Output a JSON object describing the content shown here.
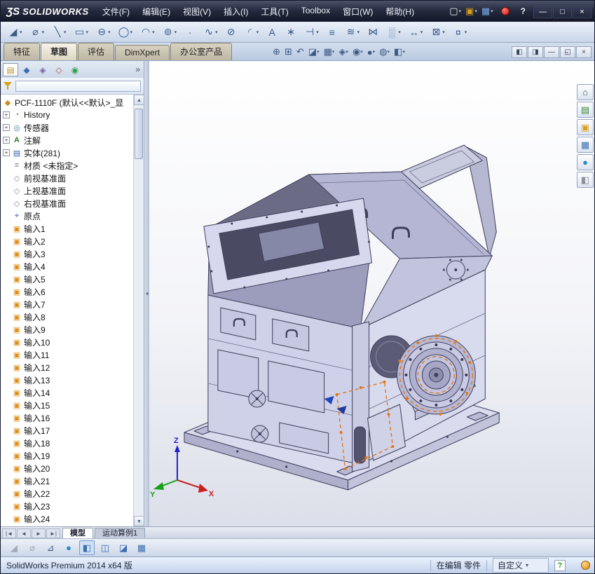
{
  "colors": {
    "accent_orange": "#e07818",
    "model_lavender": "#cfd1e8",
    "status_green": "#2e9e2e",
    "selection_blue": "#2a55c8"
  },
  "titlebar": {
    "logo_mark": "ƷS",
    "logo_text": "SOLIDWORKS",
    "menus": [
      {
        "label": "文件(F)"
      },
      {
        "label": "编辑(E)"
      },
      {
        "label": "视图(V)"
      },
      {
        "label": "插入(I)"
      },
      {
        "label": "工具(T)"
      },
      {
        "label": "Toolbox"
      },
      {
        "label": "窗口(W)"
      },
      {
        "label": "帮助(H)"
      }
    ],
    "quick_tools": [
      {
        "name": "new-document-button",
        "glyph": "▢",
        "dd": "▾",
        "tone": "tone-white"
      },
      {
        "name": "open-button",
        "glyph": "▣",
        "dd": "▾",
        "tone": "tone-gold"
      },
      {
        "name": "save-button",
        "glyph": "▦",
        "dd": "▾",
        "tone": "tone-blue"
      }
    ],
    "help_glyph": "?",
    "window_buttons": [
      {
        "name": "minimize-button",
        "glyph": "—"
      },
      {
        "name": "maximize-button",
        "glyph": "□"
      },
      {
        "name": "close-button",
        "glyph": "×"
      }
    ]
  },
  "sketch_toolbar": {
    "items": [
      {
        "name": "sketch-tool-icon",
        "glyph": "◢",
        "dd": "▾",
        "tone": "tone-warm"
      },
      {
        "name": "smart-dimension-icon",
        "glyph": "⌀",
        "dd": "▾",
        "tone": ""
      },
      {
        "name": "line-icon",
        "glyph": "╲",
        "dd": "▾",
        "tone": ""
      },
      {
        "name": "rectangle-icon",
        "glyph": "▭",
        "dd": "▾",
        "tone": ""
      },
      {
        "name": "slot-icon",
        "glyph": "⊖",
        "dd": "▾",
        "tone": ""
      },
      {
        "name": "circle-icon",
        "glyph": "◯",
        "dd": "▾",
        "tone": ""
      },
      {
        "name": "arc-icon",
        "glyph": "◠",
        "dd": "▾",
        "tone": ""
      },
      {
        "name": "spiral-icon",
        "glyph": "⊚",
        "dd": "▾",
        "tone": "tone-warm"
      },
      {
        "name": "point-icon",
        "glyph": "∙",
        "dd": "",
        "tone": ""
      },
      {
        "name": "spline-icon",
        "glyph": "∿",
        "dd": "▾",
        "tone": ""
      },
      {
        "name": "ellipse-icon",
        "glyph": "⊘",
        "dd": "",
        "tone": ""
      },
      {
        "name": "fillet-icon",
        "glyph": "◜",
        "dd": "▾",
        "tone": ""
      },
      {
        "name": "text-icon",
        "glyph": "A",
        "dd": "",
        "tone": ""
      },
      {
        "name": "pattern-star-icon",
        "glyph": "∗",
        "dd": "",
        "tone": ""
      },
      {
        "name": "trim-entities-icon",
        "glyph": "⊣",
        "dd": "▾",
        "tone": ""
      },
      {
        "name": "convert-entities-icon",
        "glyph": "≡",
        "dd": "",
        "tone": ""
      },
      {
        "name": "offset-entities-icon",
        "glyph": "≋",
        "dd": "▾",
        "tone": ""
      },
      {
        "name": "mirror-entities-icon",
        "glyph": "⋈",
        "dd": "",
        "tone": ""
      },
      {
        "name": "linear-pattern-icon",
        "glyph": "░",
        "dd": "▾",
        "tone": ""
      },
      {
        "name": "move-entities-icon",
        "glyph": "↔",
        "dd": "▾",
        "tone": ""
      },
      {
        "name": "display-relations-icon",
        "glyph": "⊠",
        "dd": "▾",
        "tone": ""
      },
      {
        "name": "quick-snaps-icon",
        "glyph": "¤",
        "dd": "▾",
        "tone": "tone-warm"
      }
    ]
  },
  "ribbon": {
    "tabs": [
      {
        "label": "特征",
        "state": ""
      },
      {
        "label": "草图",
        "state": "active"
      },
      {
        "label": "评估",
        "state": ""
      },
      {
        "label": "DimXpert",
        "state": ""
      },
      {
        "label": "办公室产品",
        "state": ""
      }
    ],
    "view_tools": [
      {
        "name": "zoom-to-fit-icon",
        "glyph": "⊕",
        "dd": "",
        "tone": ""
      },
      {
        "name": "zoom-to-area-icon",
        "glyph": "⊞",
        "dd": "",
        "tone": ""
      },
      {
        "name": "previous-view-icon",
        "glyph": "↶",
        "dd": "",
        "tone": ""
      },
      {
        "name": "section-view-icon",
        "glyph": "◪",
        "dd": "▾",
        "tone": ""
      },
      {
        "name": "view-orientation-icon",
        "glyph": "▦",
        "dd": "▾",
        "tone": ""
      },
      {
        "name": "display-style-icon",
        "glyph": "◈",
        "dd": "▾",
        "tone": ""
      },
      {
        "name": "hide-show-items-icon",
        "glyph": "◉",
        "dd": "▾",
        "tone": ""
      },
      {
        "name": "edit-appearance-icon",
        "glyph": "●",
        "dd": "▾",
        "tone": "tone-ball1"
      },
      {
        "name": "apply-scene-icon",
        "glyph": "◍",
        "dd": "▾",
        "tone": "tone-ball2"
      },
      {
        "name": "view-settings-icon",
        "glyph": "◧",
        "dd": "▾",
        "tone": ""
      }
    ],
    "doc_buttons": [
      {
        "name": "pane-left-button",
        "glyph": "◧"
      },
      {
        "name": "pane-right-button",
        "glyph": "◨"
      },
      {
        "name": "minimize-document-button",
        "glyph": "—"
      },
      {
        "name": "restore-document-button",
        "glyph": "◱"
      },
      {
        "name": "close-document-button",
        "glyph": "×"
      }
    ]
  },
  "panel": {
    "tabs": [
      {
        "name": "featuremanager-tab",
        "glyph": "▤",
        "tone": "tone-gold2",
        "state": "pressed"
      },
      {
        "name": "propertymanager-tab",
        "glyph": "◆",
        "tone": "tone-teal",
        "state": ""
      },
      {
        "name": "configurationmanager-tab",
        "glyph": "◈",
        "tone": "tone-purple",
        "state": ""
      },
      {
        "name": "dimxpertmanager-tab",
        "glyph": "◇",
        "tone": "tone-red",
        "state": ""
      },
      {
        "name": "displaymanager-tab",
        "glyph": "◉",
        "tone": "tone-ball2",
        "state": ""
      }
    ],
    "overflow_glyph": "»",
    "filter": {
      "placeholder": ""
    }
  },
  "feature_tree": {
    "root": {
      "label": "PCF-1110F (默认<<默认>_显",
      "glyph": "◆",
      "icon": "part-icon"
    },
    "items": [
      {
        "expand": "+",
        "glyph": "◔",
        "icon": "history-folder-icon",
        "label": "History"
      },
      {
        "expand": "+",
        "glyph": "◎",
        "icon": "sensors-icon",
        "label": "传感器"
      },
      {
        "expand": "+",
        "glyph": "A",
        "icon": "annotations-icon",
        "label": "注解"
      },
      {
        "expand": "+",
        "glyph": "▤",
        "icon": "solid-bodies-folder-icon",
        "label": "实体(281)"
      },
      {
        "expand": "",
        "glyph": "≡",
        "icon": "material-icon",
        "label": "材质 <未指定>"
      },
      {
        "expand": "",
        "glyph": "◇",
        "icon": "plane-icon",
        "label": "前视基准面"
      },
      {
        "expand": "",
        "glyph": "◇",
        "icon": "plane-icon",
        "label": "上视基准面"
      },
      {
        "expand": "",
        "glyph": "◇",
        "icon": "plane-icon",
        "label": "右视基准面"
      },
      {
        "expand": "",
        "glyph": "⌖",
        "icon": "origin-icon",
        "label": "原点"
      },
      {
        "expand": "",
        "glyph": "▣",
        "icon": "imported-feature-icon",
        "label": "输入1"
      },
      {
        "expand": "",
        "glyph": "▣",
        "icon": "imported-feature-icon",
        "label": "输入2"
      },
      {
        "expand": "",
        "glyph": "▣",
        "icon": "imported-feature-icon",
        "label": "输入3"
      },
      {
        "expand": "",
        "glyph": "▣",
        "icon": "imported-feature-icon",
        "label": "输入4"
      },
      {
        "expand": "",
        "glyph": "▣",
        "icon": "imported-feature-icon",
        "label": "输入5"
      },
      {
        "expand": "",
        "glyph": "▣",
        "icon": "imported-feature-icon",
        "label": "输入6"
      },
      {
        "expand": "",
        "glyph": "▣",
        "icon": "imported-feature-icon",
        "label": "输入7"
      },
      {
        "expand": "",
        "glyph": "▣",
        "icon": "imported-feature-icon",
        "label": "输入8"
      },
      {
        "expand": "",
        "glyph": "▣",
        "icon": "imported-feature-icon",
        "label": "输入9"
      },
      {
        "expand": "",
        "glyph": "▣",
        "icon": "imported-feature-icon",
        "label": "输入10"
      },
      {
        "expand": "",
        "glyph": "▣",
        "icon": "imported-feature-icon",
        "label": "输入11"
      },
      {
        "expand": "",
        "glyph": "▣",
        "icon": "imported-feature-icon",
        "label": "输入12"
      },
      {
        "expand": "",
        "glyph": "▣",
        "icon": "imported-feature-icon",
        "label": "输入13"
      },
      {
        "expand": "",
        "glyph": "▣",
        "icon": "imported-feature-icon",
        "label": "输入14"
      },
      {
        "expand": "",
        "glyph": "▣",
        "icon": "imported-feature-icon",
        "label": "输入15"
      },
      {
        "expand": "",
        "glyph": "▣",
        "icon": "imported-feature-icon",
        "label": "输入16"
      },
      {
        "expand": "",
        "glyph": "▣",
        "icon": "imported-feature-icon",
        "label": "输入17"
      },
      {
        "expand": "",
        "glyph": "▣",
        "icon": "imported-feature-icon",
        "label": "输入18"
      },
      {
        "expand": "",
        "glyph": "▣",
        "icon": "imported-feature-icon",
        "label": "输入19"
      },
      {
        "expand": "",
        "glyph": "▣",
        "icon": "imported-feature-icon",
        "label": "输入20"
      },
      {
        "expand": "",
        "glyph": "▣",
        "icon": "imported-feature-icon",
        "label": "输入21"
      },
      {
        "expand": "",
        "glyph": "▣",
        "icon": "imported-feature-icon",
        "label": "输入22"
      },
      {
        "expand": "",
        "glyph": "▣",
        "icon": "imported-feature-icon",
        "label": "输入23"
      },
      {
        "expand": "",
        "glyph": "▣",
        "icon": "imported-feature-icon",
        "label": "输入24"
      }
    ]
  },
  "viewport": {
    "triad": {
      "x_label": "X",
      "y_label": "Y",
      "z_label": "Z"
    }
  },
  "task_pane": [
    {
      "name": "resources-tab",
      "glyph": "⌂",
      "tone": "tone-home"
    },
    {
      "name": "design-library-tab",
      "glyph": "▤",
      "tone": "tone-green"
    },
    {
      "name": "file-explorer-tab",
      "glyph": "▣",
      "tone": "tone-gold"
    },
    {
      "name": "view-palette-tab",
      "glyph": "▦",
      "tone": "tone-teal"
    },
    {
      "name": "appearances-tab",
      "glyph": "●",
      "tone": "tone-ball1"
    },
    {
      "name": "custom-properties-tab",
      "glyph": "◧",
      "tone": "tone-gray"
    }
  ],
  "bottom_tabs": {
    "nav": [
      {
        "name": "first-tab-button",
        "glyph": "|◄"
      },
      {
        "name": "prev-tab-button",
        "glyph": "◄"
      },
      {
        "name": "next-tab-button",
        "glyph": "►"
      },
      {
        "name": "last-tab-button",
        "glyph": "►|"
      }
    ],
    "tabs": [
      {
        "label": "模型",
        "state": "active"
      },
      {
        "label": "运动算例1",
        "state": ""
      }
    ]
  },
  "bottom_toolbar": [
    {
      "name": "sketch-icon",
      "glyph": "◢",
      "state": "disabled",
      "tone": ""
    },
    {
      "name": "smart-dimension-icon",
      "glyph": "⌀",
      "state": "disabled",
      "tone": ""
    },
    {
      "name": "measure-icon",
      "glyph": "⊿",
      "state": "",
      "tone": ""
    },
    {
      "name": "appearance-ball-icon",
      "glyph": "●",
      "state": "",
      "tone": "tone-ball1"
    },
    {
      "name": "shaded-with-edges-icon",
      "glyph": "◧",
      "state": "pressed",
      "tone": "tone-teal"
    },
    {
      "name": "hidden-lines-visible-icon",
      "glyph": "◫",
      "state": "",
      "tone": "tone-teal"
    },
    {
      "name": "section-view-icon",
      "glyph": "◪",
      "state": "",
      "tone": "tone-teal"
    },
    {
      "name": "view-orientation-icon",
      "glyph": "▦",
      "state": "",
      "tone": "tone-teal"
    }
  ],
  "statusbar": {
    "product": "SolidWorks Premium 2014 x64 版",
    "editing": "在编辑 零件",
    "custom_label": "自定义",
    "custom_dd": "▾",
    "help_glyph": "?"
  }
}
